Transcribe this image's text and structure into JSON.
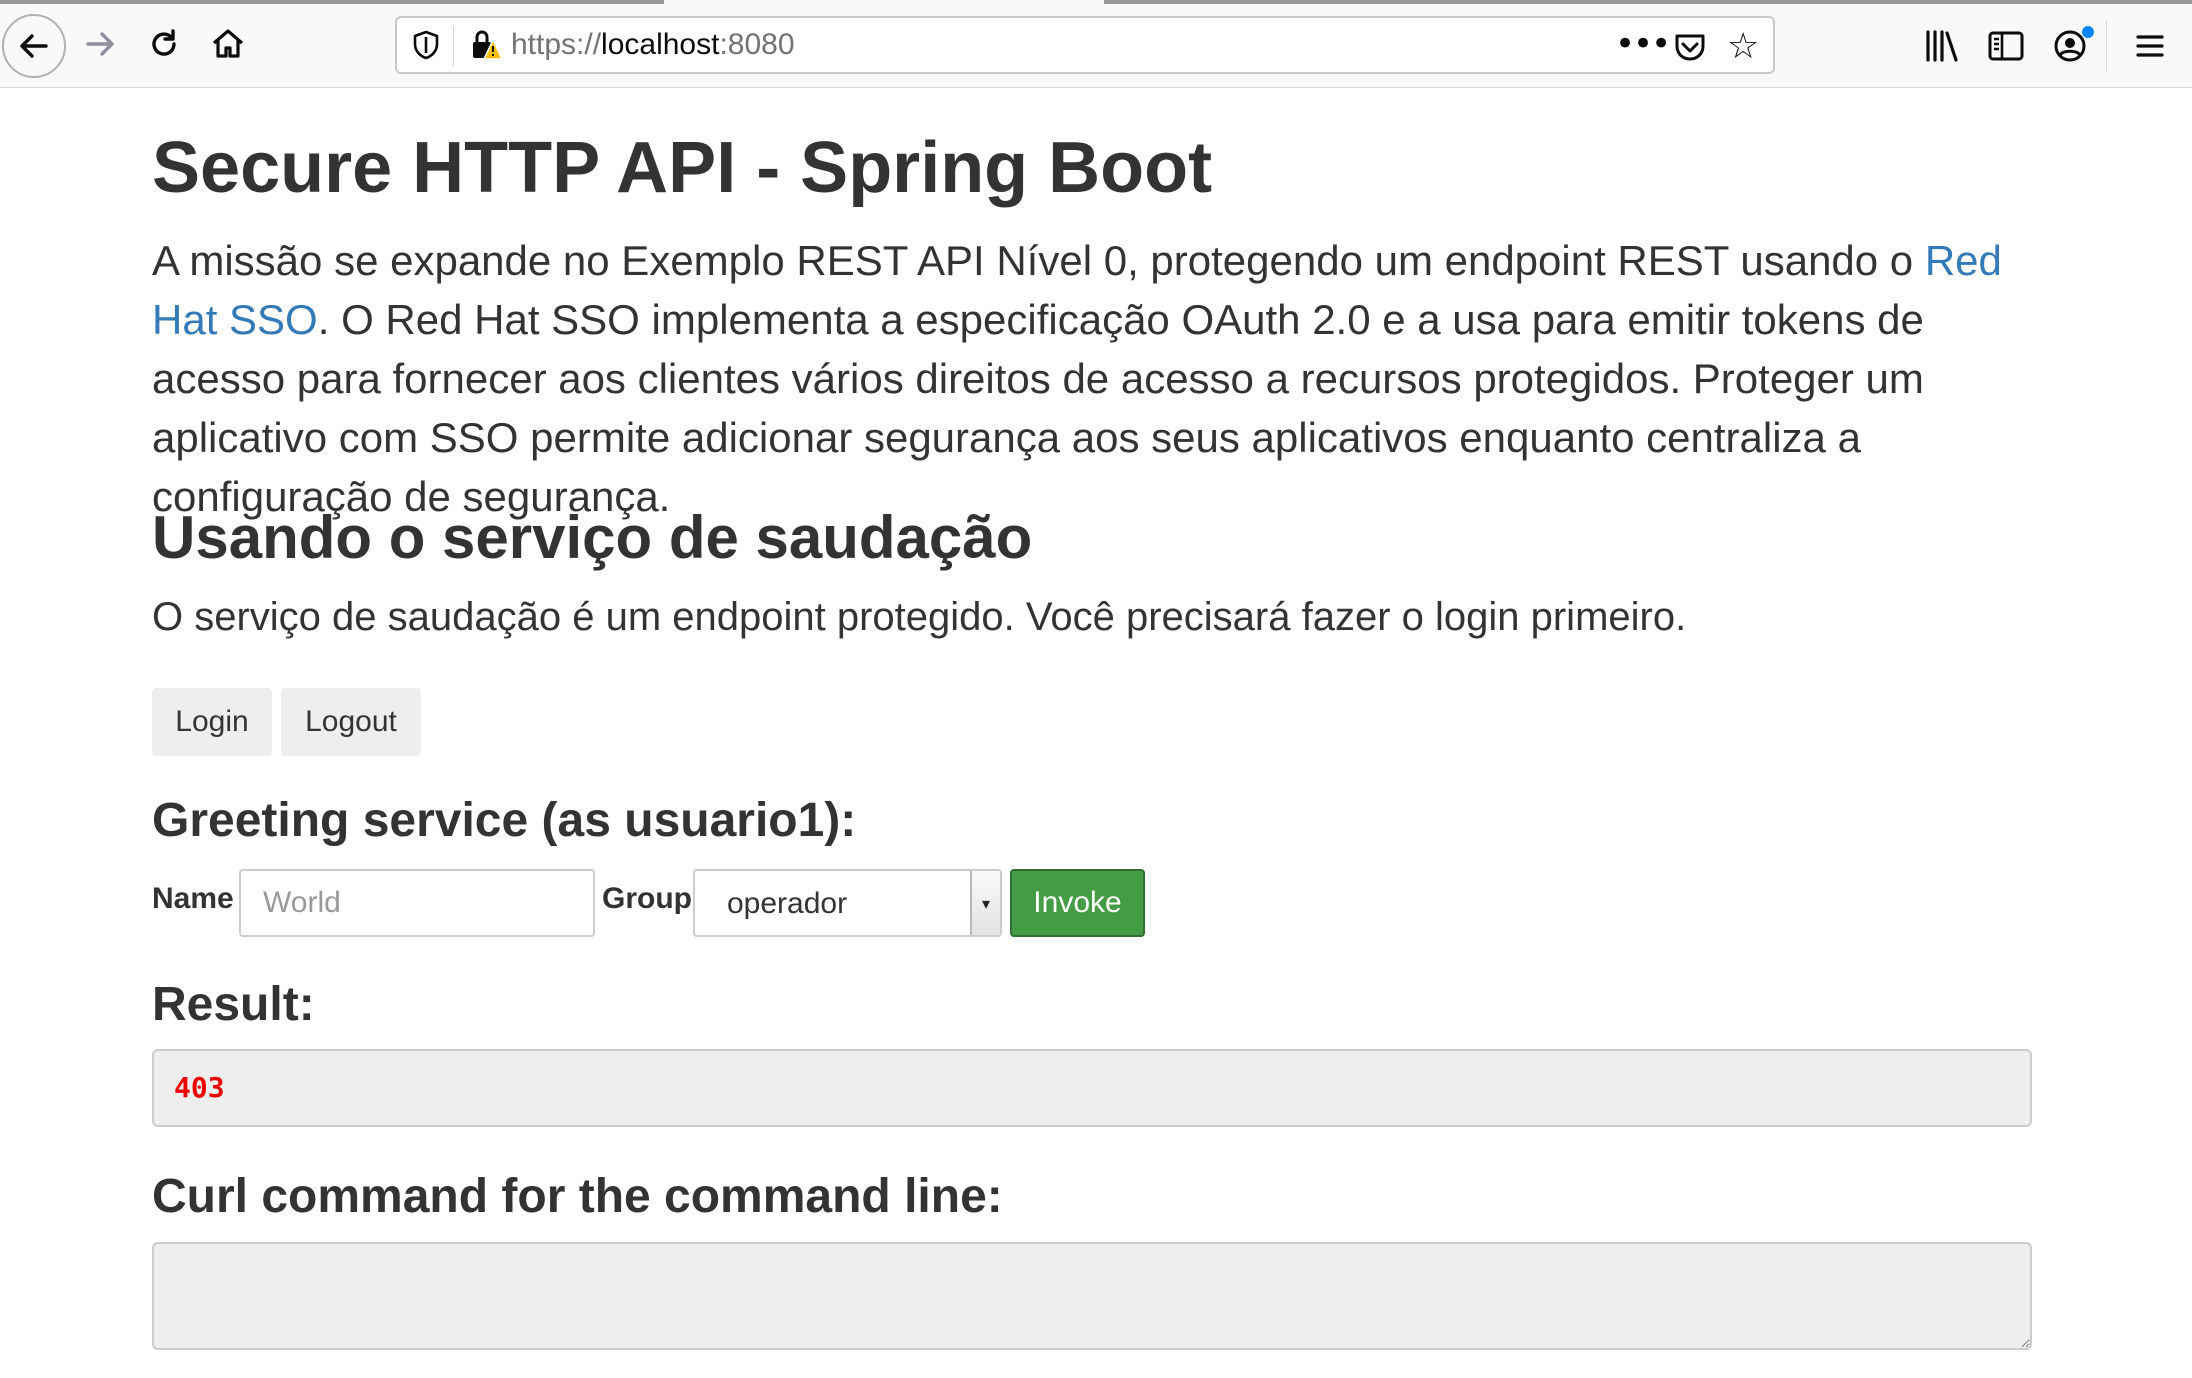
{
  "browser": {
    "url_scheme": "https://",
    "url_host": "localhost",
    "url_port": ":8080",
    "icons": [
      "back-arrow-icon",
      "forward-arrow-icon",
      "reload-icon",
      "home-icon",
      "shield-icon",
      "insecure-lock-icon",
      "more-actions-icon",
      "pocket-icon",
      "bookmark-star-icon",
      "library-icon",
      "sidebar-icon",
      "account-icon",
      "hamburger-menu-icon"
    ]
  },
  "page": {
    "title": "Secure HTTP API - Spring Boot",
    "lead_part1": "A missão se expande no Exemplo REST API Nível 0, protegendo um endpoint REST usando o ",
    "lead_link": "Red Hat SSO",
    "lead_part2": ". O Red Hat SSO implementa a especificação OAuth 2.0 e a usa para emitir tokens de acesso para fornecer aos clientes vários direitos de acesso a recursos protegidos. Proteger um aplicativo com SSO permite adicionar segurança aos seus aplicativos enquanto centraliza a configuração de segurança.",
    "section_title": "Usando o serviço de saudação",
    "section_text": "O serviço de saudação é um endpoint protegido. Você precisará fazer o login primeiro.",
    "login_label": "Login",
    "logout_label": "Logout",
    "greeting_title": "Greeting service (as usuario1):",
    "name_label": "Name",
    "name_placeholder": "World",
    "group_label": "Group",
    "group_selected": "operador",
    "invoke_label": "Invoke",
    "result_title": "Result:",
    "result_value": "403",
    "curl_title": "Curl command for the command line:",
    "curl_value": ""
  },
  "colors": {
    "link": "#337ab7",
    "invoke_button": "#449d44",
    "result_error": "#ee0000",
    "account_badge": "#0a84ff"
  }
}
